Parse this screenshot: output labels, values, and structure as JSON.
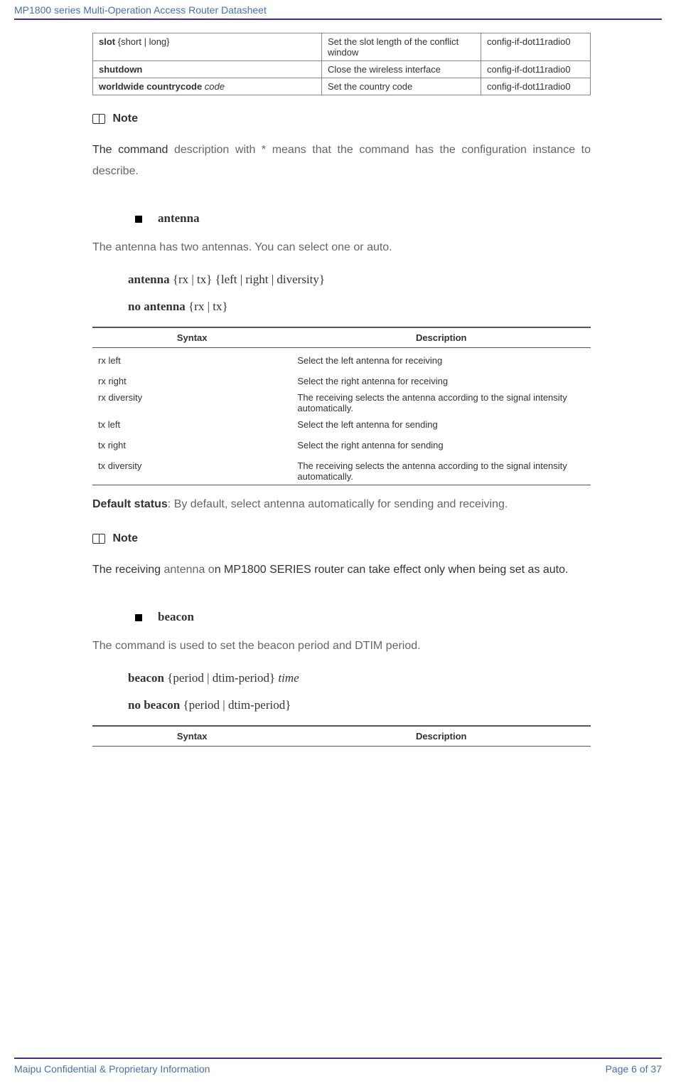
{
  "header": {
    "title": "MP1800 series Multi-Operation Access Router Datasheet"
  },
  "cmd_table": {
    "rows": [
      {
        "c1_bold": "slot",
        "c1_rest": " {short | long}",
        "c2": "Set the slot length of the conflict window",
        "c3": "config-if-dot11radio0"
      },
      {
        "c1_bold": "shutdown",
        "c1_rest": "",
        "c2": "Close the wireless interface",
        "c3": "config-if-dot11radio0"
      },
      {
        "c1_bold": "worldwide countrycode ",
        "c1_italic": "code",
        "c2": "Set the country code",
        "c3": "config-if-dot11radio0"
      }
    ]
  },
  "note1": {
    "label": " Note",
    "text_dark": "The command ",
    "text_light": "description with * means that the command has the configuration instance to describe."
  },
  "antenna": {
    "heading": "antenna",
    "desc": "The antenna has two antennas. You can select one or auto.",
    "cmd1_b": "antenna ",
    "cmd1_rest": "{rx | tx} {left | right | diversity}",
    "cmd2_b": "no antenna ",
    "cmd2_rest": "{rx | tx}",
    "syntax_hdr": "Syntax",
    "desc_hdr": "Description",
    "rows": [
      {
        "s": "rx left",
        "d": "Select the left antenna for receiving",
        "spaced": true
      },
      {
        "s": "rx right",
        "d": "Select the right antenna for receiving"
      },
      {
        "s": "rx diversity",
        "d": "The receiving selects the antenna according to the signal intensity automatically."
      },
      {
        "s": "tx left",
        "d": "Select the left antenna for sending"
      },
      {
        "s": "tx right",
        "d": "Select the right antenna for sending",
        "spaced": true
      },
      {
        "s": "tx diversity",
        "d": "The receiving selects the antenna according to the signal intensity automatically."
      }
    ],
    "default_b": "Default status",
    "default_rest": ": By default, select antenna automatically for sending and receiving."
  },
  "note2": {
    "label": " Note",
    "t1_dark": "The receiving ",
    "t1_light": "antenna o",
    "t2_dark": "n MP1800 SERIES router can take effect only when being set as auto."
  },
  "beacon": {
    "heading": "beacon",
    "desc": "The command is used to set the beacon period and DTIM period.",
    "cmd1_b": "beacon ",
    "cmd1_rest": "{period | dtim-period} ",
    "cmd1_i": "time",
    "cmd2_b": "no beacon ",
    "cmd2_rest": "{period | dtim-period}",
    "syntax_hdr": "Syntax",
    "desc_hdr": "Description"
  },
  "footer": {
    "left": "Maipu Confidential & Proprietary Information",
    "right": "Page 6 of 37"
  }
}
